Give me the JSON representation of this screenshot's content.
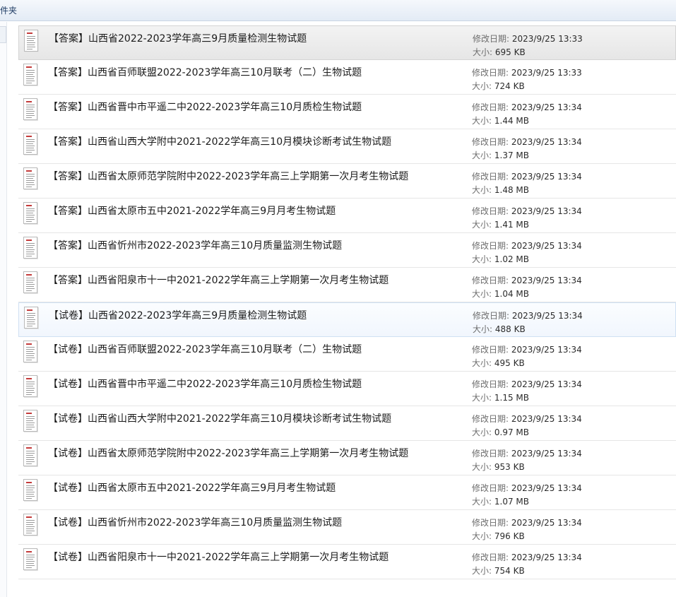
{
  "toolbar": {
    "label": "件夹"
  },
  "labels": {
    "date": "修改日期:",
    "size": "大小:"
  },
  "files": [
    {
      "name": "【答案】山西省2022-2023学年高三9月质量检测生物试题",
      "date": "2023/9/25 13:33",
      "size": "695 KB",
      "state": "selected"
    },
    {
      "name": "【答案】山西省百师联盟2022-2023学年高三10月联考（二）生物试题",
      "date": "2023/9/25 13:33",
      "size": "724 KB",
      "state": ""
    },
    {
      "name": "【答案】山西省晋中市平遥二中2022-2023学年高三10月质检生物试题",
      "date": "2023/9/25 13:34",
      "size": "1.44 MB",
      "state": ""
    },
    {
      "name": "【答案】山西省山西大学附中2021-2022学年高三10月模块诊断考试生物试题",
      "date": "2023/9/25 13:34",
      "size": "1.37 MB",
      "state": ""
    },
    {
      "name": "【答案】山西省太原师范学院附中2022-2023学年高三上学期第一次月考生物试题",
      "date": "2023/9/25 13:34",
      "size": "1.48 MB",
      "state": ""
    },
    {
      "name": "【答案】山西省太原市五中2021-2022学年高三9月月考生物试题",
      "date": "2023/9/25 13:34",
      "size": "1.41 MB",
      "state": ""
    },
    {
      "name": "【答案】山西省忻州市2022-2023学年高三10月质量监测生物试题",
      "date": "2023/9/25 13:34",
      "size": "1.02 MB",
      "state": ""
    },
    {
      "name": "【答案】山西省阳泉市十一中2021-2022学年高三上学期第一次月考生物试题",
      "date": "2023/9/25 13:34",
      "size": "1.04 MB",
      "state": ""
    },
    {
      "name": "【试卷】山西省2022-2023学年高三9月质量检测生物试题",
      "date": "2023/9/25 13:34",
      "size": "488 KB",
      "state": "hover"
    },
    {
      "name": "【试卷】山西省百师联盟2022-2023学年高三10月联考（二）生物试题",
      "date": "2023/9/25 13:34",
      "size": "495 KB",
      "state": ""
    },
    {
      "name": "【试卷】山西省晋中市平遥二中2022-2023学年高三10月质检生物试题",
      "date": "2023/9/25 13:34",
      "size": "1.15 MB",
      "state": ""
    },
    {
      "name": "【试卷】山西省山西大学附中2021-2022学年高三10月模块诊断考试生物试题",
      "date": "2023/9/25 13:34",
      "size": "0.97 MB",
      "state": ""
    },
    {
      "name": "【试卷】山西省太原师范学院附中2022-2023学年高三上学期第一次月考生物试题",
      "date": "2023/9/25 13:34",
      "size": "953 KB",
      "state": ""
    },
    {
      "name": "【试卷】山西省太原市五中2021-2022学年高三9月月考生物试题",
      "date": "2023/9/25 13:34",
      "size": "1.07 MB",
      "state": ""
    },
    {
      "name": "【试卷】山西省忻州市2022-2023学年高三10月质量监测生物试题",
      "date": "2023/9/25 13:34",
      "size": "796 KB",
      "state": ""
    },
    {
      "name": "【试卷】山西省阳泉市十一中2021-2022学年高三上学期第一次月考生物试题",
      "date": "2023/9/25 13:34",
      "size": "754 KB",
      "state": ""
    }
  ]
}
